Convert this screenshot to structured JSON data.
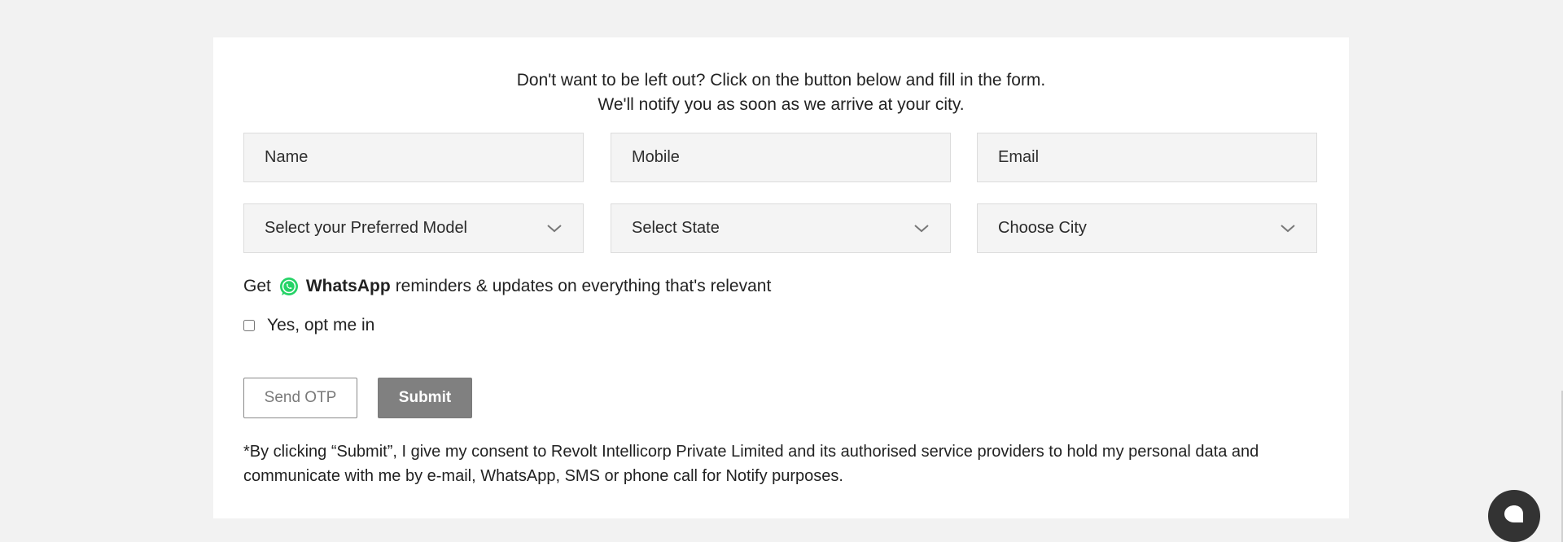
{
  "intro": {
    "line1": "Don't want to be left out? Click on the button below and fill in the form.",
    "line2": "We'll notify you as soon as we arrive at your city."
  },
  "form": {
    "name_placeholder": "Name",
    "mobile_placeholder": "Mobile",
    "email_placeholder": "Email",
    "model_select": "Select your Preferred Model",
    "state_select": "Select State",
    "city_select": "Choose City"
  },
  "whatsapp": {
    "prefix": "Get",
    "brand": "WhatsApp",
    "suffix": "reminders & updates on everything that's relevant",
    "optin_label": "Yes, opt me in",
    "icon": "whatsapp-icon",
    "brand_color": "#25D366"
  },
  "buttons": {
    "send_otp": "Send OTP",
    "submit": "Submit"
  },
  "consent": {
    "text": "*By clicking “Submit”, I give my consent to Revolt Intellicorp Private Limited and its authorised service providers to hold my personal data and communicate with me by e-mail, WhatsApp, SMS or phone call for Notify purposes."
  },
  "icons": {
    "chevron": "chevron-down-icon",
    "chat": "chat-icon"
  },
  "colors": {
    "background": "#f2f2f2",
    "card": "#ffffff",
    "submit_bg": "#808080",
    "chat_bg": "#333333"
  }
}
